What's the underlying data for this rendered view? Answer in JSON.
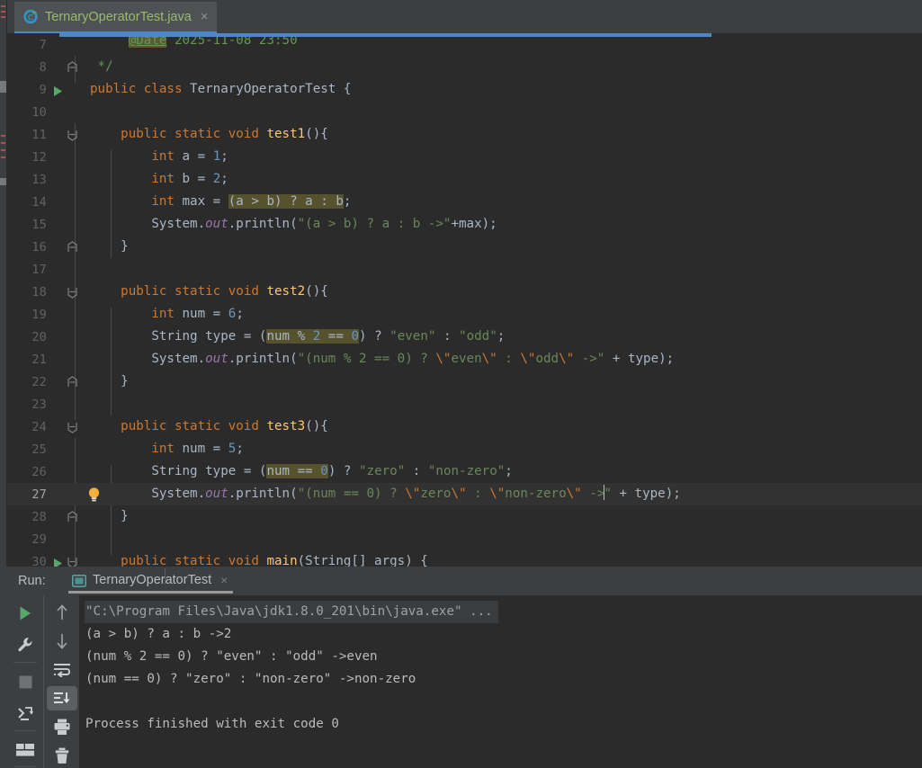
{
  "window": {
    "theme_bg": "#2b2b2b",
    "panel_bg": "#3c3f41",
    "accent": "#4a88c7"
  },
  "tab_bar": {
    "tabs": [
      {
        "title": "TernaryOperatorTest.java",
        "icon": "java-class-run-icon",
        "close_label": "×",
        "active": true
      }
    ]
  },
  "editor": {
    "lines": [
      {
        "num": "7",
        "partial": true
      },
      {
        "num": "8",
        "fold": "end"
      },
      {
        "num": "9",
        "run_marker": true
      },
      {
        "num": "10"
      },
      {
        "num": "11",
        "fold": "start"
      },
      {
        "num": "12"
      },
      {
        "num": "13"
      },
      {
        "num": "14"
      },
      {
        "num": "15"
      },
      {
        "num": "16",
        "fold": "end"
      },
      {
        "num": "17"
      },
      {
        "num": "18",
        "fold": "start"
      },
      {
        "num": "19"
      },
      {
        "num": "20"
      },
      {
        "num": "21"
      },
      {
        "num": "22",
        "fold": "end"
      },
      {
        "num": "23"
      },
      {
        "num": "24",
        "fold": "start"
      },
      {
        "num": "25"
      },
      {
        "num": "26"
      },
      {
        "num": "27",
        "bulb": true,
        "current": true
      },
      {
        "num": "28",
        "fold": "end"
      },
      {
        "num": "29"
      },
      {
        "num": "30",
        "run_marker": true,
        "fold": "start"
      }
    ],
    "code_text": {
      "l7": "@Date 2025-11-08 23:50",
      "l8": "*/",
      "l9": "public class TernaryOperatorTest {",
      "l10": "",
      "l11": "public static void test1(){",
      "l12": "int a = 1;",
      "l13": "int b = 2;",
      "l14": "int max = (a > b) ? a : b;",
      "l15": "System.out.println(\"(a > b) ? a : b ->\"+max);",
      "l16": "}",
      "l17": "",
      "l18": "public static void test2(){",
      "l19": "int num = 6;",
      "l20": "String type = (num % 2 == 0) ? \"even\" : \"odd\";",
      "l21": "System.out.println(\"(num % 2 == 0) ? \\\"even\\\" : \\\"odd\\\" ->\" + type);",
      "l22": "}",
      "l23": "",
      "l24": "public static void test3(){",
      "l25": "int num = 5;",
      "l26": "String type = (num == 0) ? \"zero\" : \"non-zero\";",
      "l27": "System.out.println(\"(num == 0) ? \\\"zero\\\" : \\\"non-zero\\\" ->\" + type);",
      "l28": "}",
      "l29": "",
      "l30": "public static void main(String[] args) {"
    },
    "highlighted_expressions": [
      "(a > b) ? a : b",
      "num % 2 == 0",
      "num == 0"
    ],
    "caret_line": "27",
    "intention_icon": "lightbulb-icon"
  },
  "run_panel": {
    "label": "Run:",
    "tab": {
      "title": "TernaryOperatorTest",
      "icon": "console-icon",
      "close_label": "×"
    },
    "toolbar_left": [
      {
        "name": "rerun-button",
        "icon": "play-icon"
      },
      {
        "name": "edit-configurations-button",
        "icon": "wrench-icon"
      },
      {
        "name": "stop-button",
        "icon": "stop-icon"
      },
      {
        "name": "dump-threads-button",
        "icon": "thread-dump-icon"
      },
      {
        "name": "layout-button",
        "icon": "layout-icon"
      }
    ],
    "toolbar_right": [
      {
        "name": "up-button",
        "icon": "arrow-up-icon"
      },
      {
        "name": "down-button",
        "icon": "arrow-down-icon"
      },
      {
        "name": "soft-wrap-button",
        "icon": "soft-wrap-icon"
      },
      {
        "name": "scroll-to-end-button",
        "icon": "scroll-to-end-icon",
        "active": true
      },
      {
        "name": "print-button",
        "icon": "print-icon"
      },
      {
        "name": "clear-all-button",
        "icon": "trash-icon"
      }
    ],
    "console_lines": [
      {
        "text": "\"C:\\Program Files\\Java\\jdk1.8.0_201\\bin\\java.exe\" ...",
        "style": "cmd"
      },
      {
        "text": "(a > b) ? a : b ->2",
        "style": "out"
      },
      {
        "text": "(num % 2 == 0) ? \"even\" : \"odd\" ->even",
        "style": "out"
      },
      {
        "text": "(num == 0) ? \"zero\" : \"non-zero\" ->non-zero",
        "style": "out"
      },
      {
        "text": "",
        "style": "out"
      },
      {
        "text": "Process finished with exit code 0",
        "style": "out"
      }
    ]
  }
}
